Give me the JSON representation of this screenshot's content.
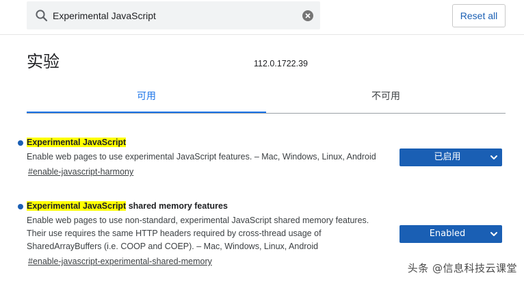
{
  "search": {
    "value": "Experimental JavaScript",
    "placeholder": ""
  },
  "header": {
    "reset_label": "Reset all"
  },
  "page": {
    "title": "实验",
    "version": "112.0.1722.39"
  },
  "tabs": [
    {
      "label": "可用",
      "active": true
    },
    {
      "label": "不可用",
      "active": false
    }
  ],
  "flags": [
    {
      "title_highlight": "Experimental JavaScript",
      "title_rest": "",
      "description": "Enable web pages to use experimental JavaScript features. – Mac, Windows, Linux, Android",
      "link": "#enable-javascript-harmony",
      "selected": "已启用"
    },
    {
      "title_highlight": "Experimental JavaScript",
      "title_rest": " shared memory features",
      "description": "Enable web pages to use non-standard, experimental JavaScript shared memory features. Their use requires the same HTTP headers required by cross-thread usage of SharedArrayBuffers (i.e. COOP and COEP). – Mac, Windows, Linux, Android",
      "link": "#enable-javascript-experimental-shared-memory",
      "selected": "Enabled"
    }
  ],
  "watermark": "头条 @信息科技云课堂",
  "colors": {
    "accent": "#1a73e8",
    "select_bg": "#1a5fb4",
    "highlight": "#ffff00"
  },
  "icons": {
    "search": "search-icon",
    "clear": "clear-icon",
    "dropdown": "chevron-down-icon"
  }
}
